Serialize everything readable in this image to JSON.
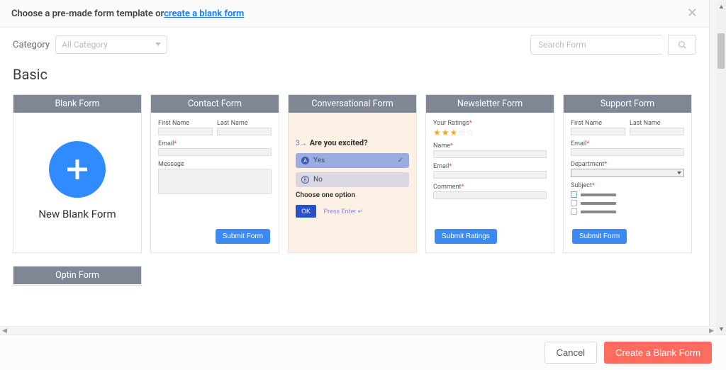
{
  "header": {
    "prefix": "Choose a pre-made form template or ",
    "link": "create a blank form"
  },
  "toolbar": {
    "category_label": "Category",
    "category_placeholder": "All Category",
    "search_placeholder": "Search Form"
  },
  "section_title": "Basic",
  "cards": {
    "blank": {
      "title": "Blank Form",
      "label": "New Blank Form"
    },
    "contact": {
      "title": "Contact Form",
      "first_name": "First Name",
      "last_name": "Last Name",
      "email": "Email",
      "message": "Message",
      "submit": "Submit Form"
    },
    "conversational": {
      "title": "Conversational Form",
      "prefix": "3→",
      "question": "Are you excited?",
      "opt_yes": "Yes",
      "opt_no": "No",
      "hint": "Choose one option",
      "ok": "OK",
      "enter": "Press Enter ↵"
    },
    "newsletter": {
      "title": "Newsletter Form",
      "ratings": "Your Ratings",
      "name": "Name",
      "email": "Email",
      "comment": "Comment",
      "submit": "Submit Ratings"
    },
    "support": {
      "title": "Support Form",
      "first_name": "First Name",
      "last_name": "Last Name",
      "email": "Email",
      "department": "Department",
      "subject": "Subject",
      "submit": "Submit Form"
    },
    "optin": {
      "title": "Optin Form"
    }
  },
  "footer": {
    "cancel": "Cancel",
    "create": "Create a Blank Form"
  },
  "letters": {
    "a": "A",
    "b": "B"
  }
}
